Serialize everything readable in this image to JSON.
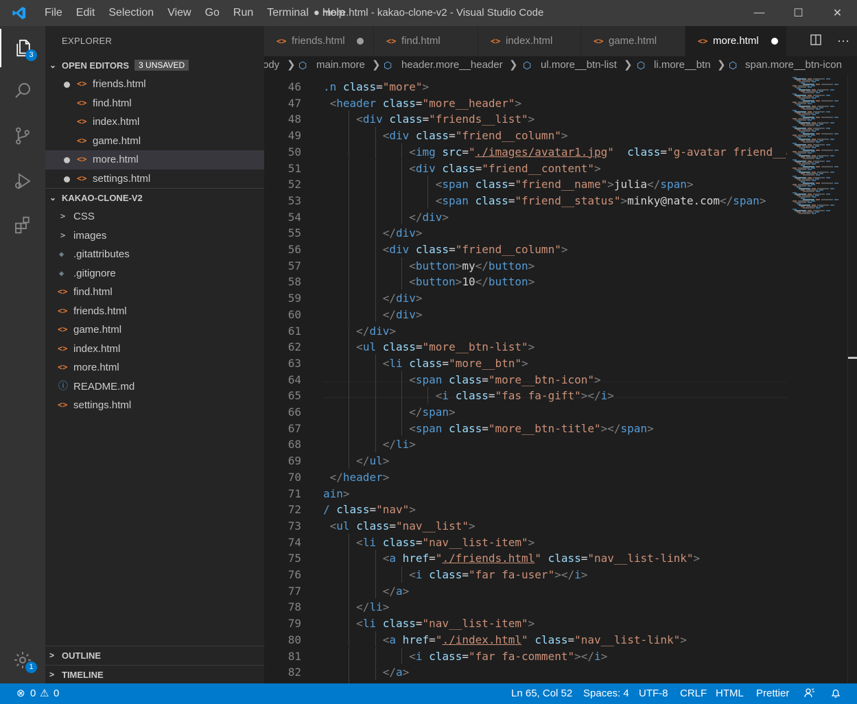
{
  "window": {
    "title": "● more.html - kakao-clone-v2 - Visual Studio Code",
    "minimize": "—",
    "maximize": "☐",
    "close": "✕"
  },
  "menu": [
    "File",
    "Edit",
    "Selection",
    "View",
    "Go",
    "Run",
    "Terminal",
    "Help"
  ],
  "activity": {
    "explorer_badge": "3",
    "settings_badge": "1"
  },
  "sidebar": {
    "title": "EXPLORER",
    "open_editors": {
      "label": "OPEN EDITORS",
      "badge": "3 UNSAVED",
      "items": [
        {
          "name": "friends.html",
          "unsaved": true
        },
        {
          "name": "find.html",
          "unsaved": false
        },
        {
          "name": "index.html",
          "unsaved": false
        },
        {
          "name": "game.html",
          "unsaved": false
        },
        {
          "name": "more.html",
          "unsaved": true
        },
        {
          "name": "settings.html",
          "unsaved": true
        }
      ]
    },
    "project": {
      "label": "KAKAO-CLONE-V2",
      "folders": [
        "CSS",
        "images"
      ],
      "files": [
        ".gitattributes",
        ".gitignore",
        "find.html",
        "friends.html",
        "game.html",
        "index.html",
        "more.html",
        "README.md",
        "settings.html"
      ]
    },
    "outline": "OUTLINE",
    "timeline": "TIMELINE"
  },
  "tabs": [
    {
      "label": "friends.html",
      "unsaved": true
    },
    {
      "label": "find.html",
      "unsaved": false
    },
    {
      "label": "index.html",
      "unsaved": false
    },
    {
      "label": "game.html",
      "unsaved": false
    },
    {
      "label": "more.html",
      "unsaved": true
    }
  ],
  "breadcrumb": [
    "ody",
    "main.more",
    "header.more__header",
    "ul.more__btn-list",
    "li.more__btn",
    "span.more__btn-icon"
  ],
  "editor": {
    "first_line": 46,
    "lines": [
      ".n class=\"more\">",
      " <header class=\"more__header\">",
      "     <div class=\"friends__list\">",
      "         <div class=\"friend__column\">",
      "             <img src=\"./images/avatar1.jpg\"  class=\"g-avatar friend__a",
      "             <div class=\"friend__content\">",
      "                 <span class=\"friend__name\">julia</span>",
      "                 <span class=\"friend__status\">minky@nate.com</span>",
      "             </div>",
      "         </div>",
      "         <div class=\"friend__column\">",
      "             <button>my</button>",
      "             <button>10</button>",
      "         </div>",
      "         </div>",
      "     </div>",
      "     <ul class=\"more__btn-list\">",
      "         <li class=\"more__btn\">",
      "             <span class=\"more__btn-icon\">",
      "                 <i class=\"fas fa-gift\"></i>",
      "             </span>",
      "             <span class=\"more__btn-title\"></span>",
      "         </li>",
      "     </ul>",
      " </header>",
      "ain>",
      "/ class=\"nav\">",
      " <ul class=\"nav__list\">",
      "     <li class=\"nav__list-item\">",
      "         <a href=\"./friends.html\" class=\"nav__list-link\">",
      "             <i class=\"far fa-user\"></i>",
      "         </a>",
      "     </li>",
      "     <li class=\"nav__list-item\">",
      "         <a href=\"./index.html\" class=\"nav__list-link\">",
      "             <i class=\"far fa-comment\"></i>",
      "         </a>",
      "     </li>"
    ]
  },
  "status": {
    "errors": "0",
    "warnings": "0",
    "position": "Ln 65, Col 52",
    "spaces": "Spaces: 4",
    "encoding": "UTF-8",
    "eol": "CRLF",
    "language": "HTML",
    "formatter": "Prettier"
  },
  "colors": {
    "accent": "#007acc",
    "html_icon": "#e37933",
    "tag": "#569cd6",
    "attr": "#9cdcfe",
    "string": "#ce9178"
  }
}
